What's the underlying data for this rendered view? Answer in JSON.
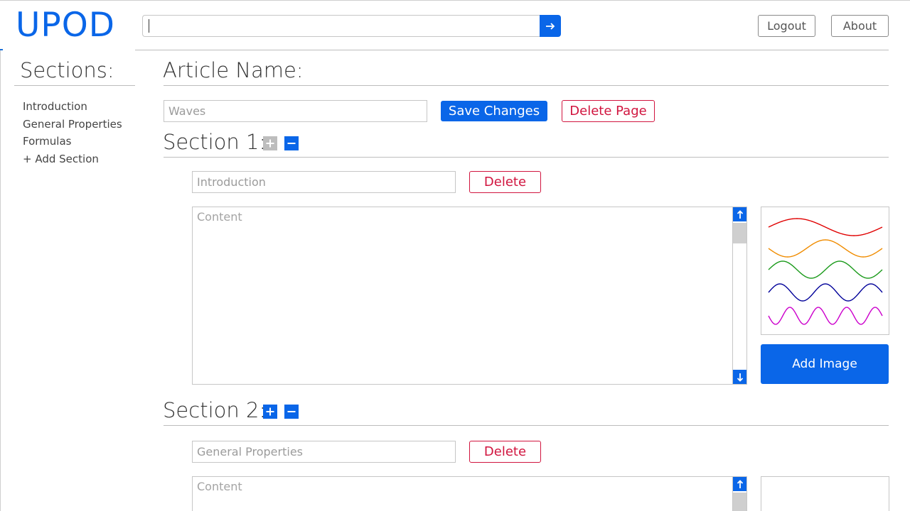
{
  "app": {
    "logo": "UPOD"
  },
  "header": {
    "search_value": "",
    "logout_label": "Logout",
    "about_label": "About"
  },
  "sidebar": {
    "title": "Sections:",
    "items": [
      {
        "label": "Introduction"
      },
      {
        "label": "General Properties"
      },
      {
        "label": "Formulas"
      },
      {
        "label": "+ Add Section"
      }
    ]
  },
  "article": {
    "title": "Article Name:",
    "name_value": "Waves",
    "save_label": "Save Changes",
    "delete_page_label": "Delete Page"
  },
  "sections": [
    {
      "title": "Section 1:",
      "name_value": "Introduction",
      "delete_label": "Delete",
      "content_placeholder": "Content",
      "add_image_label": "Add Image"
    },
    {
      "title": "Section 2:",
      "name_value": "General Properties",
      "delete_label": "Delete",
      "content_placeholder": "Content"
    }
  ],
  "colors": {
    "accent": "#0a66e8",
    "danger": "#d1153f",
    "wave_colors": [
      "#e00000",
      "#f08c00",
      "#1a9a1a",
      "#000099",
      "#cc00cc"
    ]
  },
  "icons": {
    "search_submit": "arrow-right-icon",
    "add_section": "plus-square-icon",
    "remove_section": "minus-square-icon",
    "scroll_up": "arrow-up-icon",
    "scroll_down": "arrow-down-icon"
  }
}
